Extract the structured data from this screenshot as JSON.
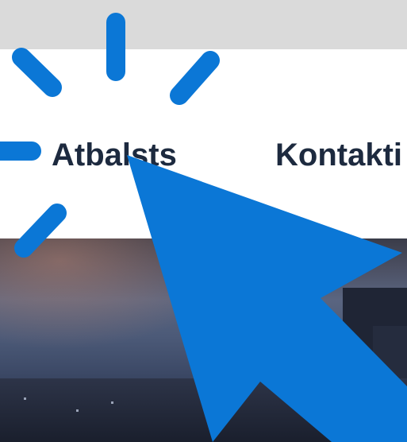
{
  "nav": {
    "items": [
      {
        "label": "Atbalsts",
        "active": true
      },
      {
        "label": "Kontakti"
      }
    ]
  },
  "cursor": {
    "icon": "mouse-pointer-arrow-icon",
    "click_indicator_icon": "click-burst-icon",
    "color": "#0b77d6"
  },
  "colors": {
    "top_bar": "#dadada",
    "nav_text": "#1d2a3f"
  }
}
